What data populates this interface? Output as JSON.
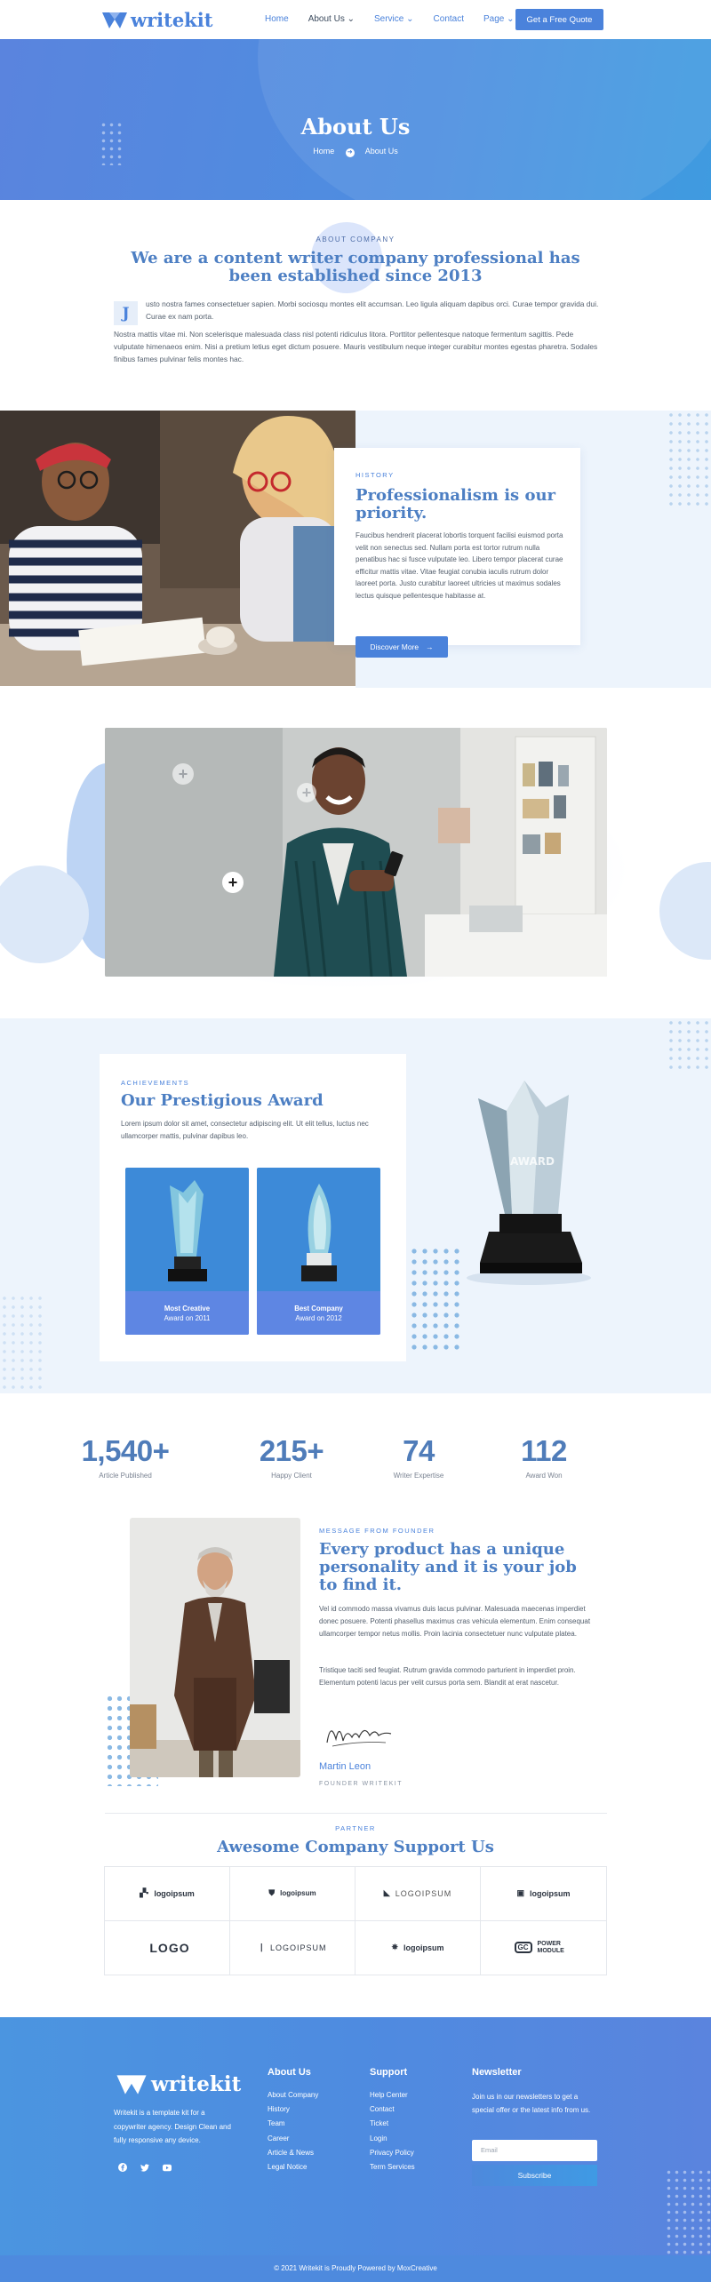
{
  "header": {
    "logo_text": "writekit",
    "nav": [
      {
        "label": "Home",
        "dropdown": false
      },
      {
        "label": "About Us",
        "dropdown": true
      },
      {
        "label": "Service",
        "dropdown": true
      },
      {
        "label": "Contact",
        "dropdown": false
      },
      {
        "label": "Page",
        "dropdown": true
      }
    ],
    "cta": "Get a Free Quote"
  },
  "hero": {
    "title": "About Us",
    "breadcrumb": {
      "home": "Home",
      "current": "About Us"
    }
  },
  "about": {
    "eyebrow": "ABOUT COMPANY",
    "title": "We are a content writer company professional has been established since 2013",
    "dropcap": "J",
    "para1": "usto nostra fames consectetuer sapien. Morbi sociosqu montes elit accumsan. Leo ligula aliquam dapibus orci. Curae tempor gravida dui. Curae ex nam porta.",
    "para2": "Nostra mattis vitae mi. Non scelerisque malesuada class nisl potenti ridiculus litora. Porttitor pellentesque natoque fermentum sagittis. Pede vulputate himenaeos enim. Nisi a pretium letius eget dictum posuere. Mauris vestibulum neque integer curabitur montes egestas pharetra. Sodales finibus fames pulvinar felis montes hac."
  },
  "history": {
    "eyebrow": "HISTORY",
    "title": "Professionalism is our priority.",
    "text": "Faucibus hendrerit placerat lobortis torquent facilisi euismod porta velit non senectus sed. Nullam porta est tortor rutrum nulla penatibus hac si fusce vulputate leo. Libero tempor placerat curae efficitur mattis vitae. Vitae feugiat conubia iaculis rutrum dolor laoreet porta. Justo curabitur laoreet ultricies ut maximus sodales lectus quisque pellentesque habitasse at.",
    "button": "Discover More"
  },
  "award": {
    "eyebrow": "ACHIEVEMENTS",
    "title": "Our Prestigious Award",
    "text": "Lorem ipsum dolor sit amet, consectetur adipiscing elit. Ut elit tellus, luctus nec ullamcorper mattis, pulvinar dapibus leo.",
    "tiles": [
      {
        "title": "Most Creative",
        "sub": "Award on 2011"
      },
      {
        "title": "Best Company",
        "sub": "Award on 2012"
      }
    ],
    "trophy_label": "AWARD"
  },
  "stats": [
    {
      "value": "1,540+",
      "label": "Article Published"
    },
    {
      "value": "215+",
      "label": "Happy Client"
    },
    {
      "value": "74",
      "label": "Writer Expertise"
    },
    {
      "value": "112",
      "label": "Award Won"
    }
  ],
  "founder": {
    "eyebrow": "MESSAGE FROM FOUNDER",
    "title": "Every product has a unique personality and it is your job to find it.",
    "para1": "Vel id commodo massa vivamus duis lacus pulvinar. Malesuada maecenas imperdiet donec posuere. Potenti phasellus maximus cras vehicula elementum. Enim consequat ullamcorper tempor netus mollis. Proin lacinia consectetuer nunc vulputate platea.",
    "para2": "Tristique taciti sed feugiat. Rutrum gravida commodo parturient in imperdiet proin. Elementum potenti lacus per velit cursus porta sem. Blandit at erat nascetur.",
    "name": "Martin Leon",
    "role": "FOUNDER WRITEKIT"
  },
  "partner": {
    "eyebrow": "PARTNER",
    "title": "Awesome Company Support Us",
    "logos": [
      {
        "text": "logoipsum",
        "icon": "blocks-logo-icon"
      },
      {
        "text": "logoipsum",
        "icon": "shield-logo-icon"
      },
      {
        "text": "LOGOIPSUM",
        "icon": "triangle-logo-icon"
      },
      {
        "text": "logoipsum",
        "icon": "square-logo-icon"
      },
      {
        "text": "LOGO",
        "icon": "outline-logo-icon"
      },
      {
        "text": "LOGOIPSUM",
        "icon": "feather-logo-icon"
      },
      {
        "text": "logoipsum",
        "icon": "pinwheel-logo-icon"
      },
      {
        "text": "POWER MODULE",
        "icon": "gc-logo-icon"
      }
    ]
  },
  "footer": {
    "logo_text": "writekit",
    "description": "Writekit is a template kit for a copywriter agency. Design Clean and fully responsive any device.",
    "about": {
      "title": "About Us",
      "links": [
        "About Company",
        "History",
        "Team",
        "Career",
        "Article & News",
        "Legal Notice"
      ]
    },
    "support": {
      "title": "Support",
      "links": [
        "Help Center",
        "Contact",
        "Ticket",
        "Login",
        "Privacy Policy",
        "Term Services"
      ]
    },
    "newsletter": {
      "title": "Newsletter",
      "text": "Join us in our newsletters to get a special offer or the latest info from us.",
      "placeholder": "Email",
      "button": "Subscribe"
    },
    "copyright": "© 2021 Writekit is Proudly Powered by MoxCreative"
  },
  "colors": {
    "brand": "#4a82db",
    "heading": "#4d7fc3",
    "soft_bg": "#edf4fc"
  }
}
